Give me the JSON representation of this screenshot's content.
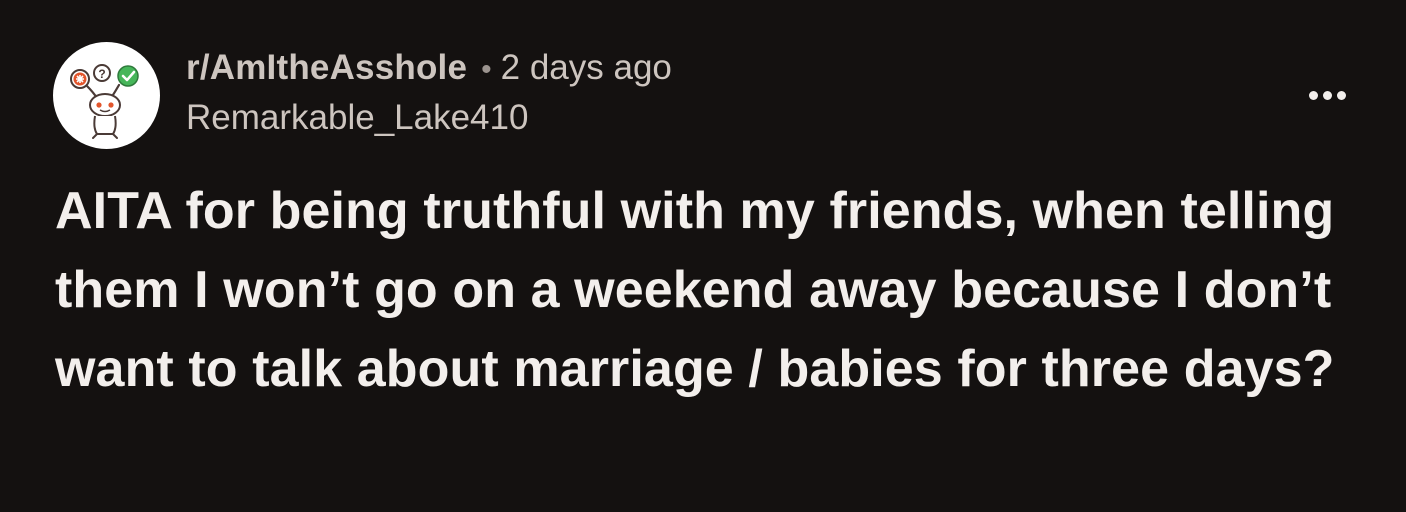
{
  "post": {
    "subreddit": "r/AmItheAsshole",
    "separator": "•",
    "time_ago": "2 days ago",
    "username": "Remarkable_Lake410",
    "title": "AITA for being truthful with my friends, when telling them I won’t go on a weekend away because I don’t want to talk about marriage / babies for three days?",
    "avatar_icon": "snoo-avatar-icon",
    "more_icon": "more-options-icon"
  },
  "colors": {
    "background": "#141110",
    "title_text": "#f3efec",
    "meta_text": "#cdc5bf",
    "avatar_bg": "#ffffff"
  }
}
